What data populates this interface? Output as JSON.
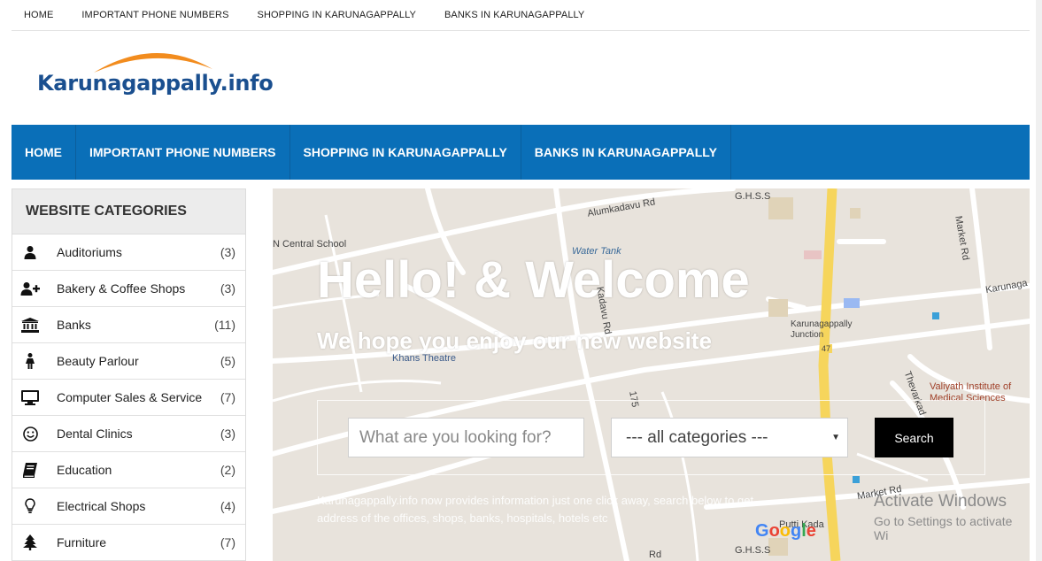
{
  "topnav": [
    "HOME",
    "IMPORTANT PHONE NUMBERS",
    "SHOPPING IN KARUNAGAPPALLY",
    "BANKS IN KARUNAGAPPALLY"
  ],
  "logo": {
    "text": "Karunagappally.info"
  },
  "mainnav": [
    "HOME",
    "IMPORTANT PHONE NUMBERS",
    "SHOPPING IN KARUNAGAPPALLY",
    "BANKS IN KARUNAGAPPALLY"
  ],
  "colors": {
    "nav_blue": "#0a6fb8",
    "logo_blue": "#1a4f8f",
    "logo_orange": "#f28c1e",
    "road_yellow": "#f6d55c"
  },
  "sidebar": {
    "title": "WEBSITE CATEGORIES",
    "items": [
      {
        "label": "Auditoriums",
        "count": "(3)",
        "icon": "person-icon"
      },
      {
        "label": "Bakery & Coffee Shops",
        "count": "(3)",
        "icon": "user-plus-icon"
      },
      {
        "label": "Banks",
        "count": "(11)",
        "icon": "bank-icon"
      },
      {
        "label": "Beauty Parlour",
        "count": "(5)",
        "icon": "female-icon"
      },
      {
        "label": "Computer Sales & Service",
        "count": "(7)",
        "icon": "monitor-icon"
      },
      {
        "label": "Dental Clinics",
        "count": "(3)",
        "icon": "smile-icon"
      },
      {
        "label": "Education",
        "count": "(2)",
        "icon": "book-icon"
      },
      {
        "label": "Electrical Shops",
        "count": "(4)",
        "icon": "lightbulb-icon"
      },
      {
        "label": "Furniture",
        "count": "(7)",
        "icon": "tree-icon"
      }
    ]
  },
  "hero": {
    "title": "Hello! & Welcome",
    "subtitle": "We hope you enjoy our new website",
    "search_placeholder": "What are you looking for?",
    "category_selected": "--- all categories ---",
    "search_button": "Search",
    "info_text": "Karunagappally.info now provides information just one click away, search below to get address of the offices, shops, banks, hospitals, hotels etc"
  },
  "map_labels": {
    "ghss_top": "G.H.S.S",
    "alumkadavu": "Alumkadavu Rd",
    "market_rd_top": "Market Rd",
    "central_school": "N Central School",
    "water_tank": "Water Tank",
    "karunaga": "Karunaga",
    "kadavu_rd": "Kadavu Rd",
    "junction": "Karunagappally Junction",
    "route_47": "47",
    "khans": "Khans Theatre",
    "thevarkad": "Thevarkad",
    "valiyath": "Valiyath Institute of Medical Sciences",
    "road_175": "175",
    "market_rd_low": "Market Rd",
    "putti_kada": "Putti Kada",
    "ghss_bottom": "G.H.S.S",
    "rd_bottom": "Rd",
    "google": "Google"
  },
  "watermark": {
    "line1": "Activate Windows",
    "line2": "Go to Settings to activate Wi"
  }
}
